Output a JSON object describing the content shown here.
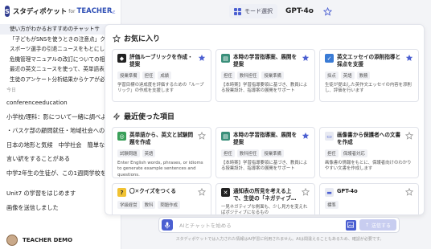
{
  "brand": {
    "name": "スタディポケット",
    "for": "for",
    "edition": "TEACHER"
  },
  "history": {
    "top_items": [
      "使い方がわかるおすすめのチャットサ",
      "「子どもがSNSを使うときの注意点」クイ",
      "スポーツ選手の引退ニュースをもとにした英",
      "危機管理マニュアルの改訂についての相談",
      "最近の英文ニュースを使って、英単語表を",
      "生徒のアンケート分析結果からケアが必要で"
    ],
    "section_today": "今日",
    "today_items": [
      "conferenceeducation",
      "小学校/理科：影について一緒に調べよ",
      "・バスケ部の顧問就任・地域社会への",
      "日本の地形と気候　中学社会　簡単な",
      "言い訳をすることがある",
      "中学2年生の生徒が、この1週間学校を",
      "Unit7 の学習をはじめます",
      "画像を送信しました"
    ]
  },
  "user": {
    "name": "TEACHER DEMO"
  },
  "topbar": {
    "mode_label": "モード選択",
    "model_name": "GPT-4o"
  },
  "favorites": {
    "title": "お気に入り",
    "cards": [
      {
        "title": "評価ルーブリックを作成・提案",
        "tags": [
          "授業準備",
          "担任",
          "成績"
        ],
        "desc": "学習目標の達成度を評価するための「ルーブリック」の作成を支援します"
      },
      {
        "title": "本時の学習指導案、展開を提案",
        "tags": [
          "担任",
          "教科担任",
          "授業準備"
        ],
        "desc": "【本時案】学習指導要領に基づき、教員による授業設計、指導案の展開をサポート"
      },
      {
        "title": "英文エッセイの添削指導と採点を支援",
        "tags": [
          "採点",
          "英語",
          "教務"
        ],
        "desc": "生徒が提出した英作文エッセイの内容を添削し、評価を行います"
      }
    ]
  },
  "recent": {
    "title": "最近使った項目",
    "cards": [
      {
        "title": "英単語から、英文と試験問題を作成",
        "tags": [
          "試験問題",
          "英語"
        ],
        "desc": "Enter English words, phrases, or idioms to generate example sentences and questions."
      },
      {
        "title": "本時の学習指導案、展開を提案",
        "tags": [
          "担任",
          "教科担任",
          "授業準備"
        ],
        "desc": "【本時案】学習指導要領に基づき、教員による授業設計、指導案の展開をサポート"
      },
      {
        "title": "画像書から保護者への文書を作成",
        "tags": [
          "担任",
          "保護者対応"
        ],
        "desc": "画像書の情報をもとに、保護者向けのわかりやすい文書を作成します"
      },
      {
        "title": "〇✕クイズをつくる",
        "tags": [
          "学級経営",
          "教科",
          "問題作成"
        ],
        "desc": ""
      },
      {
        "title": "通知表の所見を考える上で、生徒の「ネガティブ…",
        "tags": [],
        "desc": "一見ネガティブな側面も、少し見方を変えればポジティブになるもの"
      },
      {
        "title": "GPT-4o",
        "tags": [
          "標準"
        ],
        "desc": ""
      }
    ]
  },
  "input": {
    "placeholder": "AIとチャットを始める",
    "send_label": "送信する",
    "disclaimer": "スタディポケットでは入力された情報はAI学習に利用されません。AIは間違えることもあるため、確認が必要です。"
  }
}
